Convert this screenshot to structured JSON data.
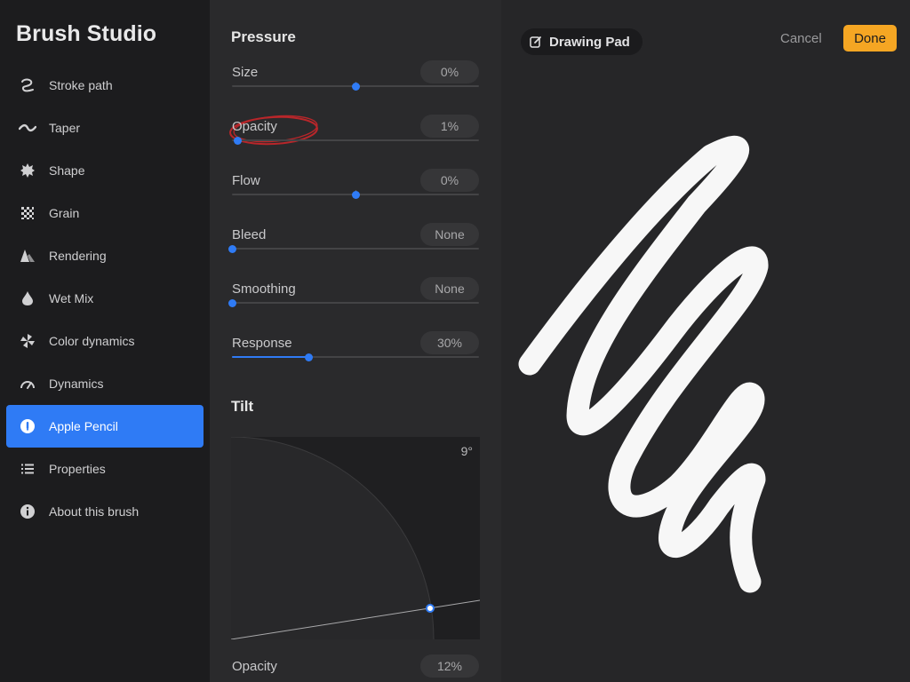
{
  "sidebar": {
    "title": "Brush Studio",
    "items": [
      {
        "label": "Stroke path",
        "icon": "stroke-path-icon"
      },
      {
        "label": "Taper",
        "icon": "taper-icon"
      },
      {
        "label": "Shape",
        "icon": "shape-icon"
      },
      {
        "label": "Grain",
        "icon": "grain-icon"
      },
      {
        "label": "Rendering",
        "icon": "rendering-icon"
      },
      {
        "label": "Wet Mix",
        "icon": "wet-mix-icon"
      },
      {
        "label": "Color dynamics",
        "icon": "color-dynamics-icon"
      },
      {
        "label": "Dynamics",
        "icon": "dynamics-icon"
      },
      {
        "label": "Apple Pencil",
        "icon": "apple-pencil-icon",
        "active": true
      },
      {
        "label": "Properties",
        "icon": "properties-icon"
      },
      {
        "label": "About this brush",
        "icon": "info-icon"
      }
    ]
  },
  "pressure": {
    "title": "Pressure",
    "settings": [
      {
        "label": "Size",
        "value": "0%",
        "level": 0.5,
        "centered": true
      },
      {
        "label": "Opacity",
        "value": "1%",
        "level": 0.02,
        "centered": false
      },
      {
        "label": "Flow",
        "value": "0%",
        "level": 0.5,
        "centered": true
      },
      {
        "label": "Bleed",
        "value": "None",
        "level": 0,
        "centered": false
      },
      {
        "label": "Smoothing",
        "value": "None",
        "level": 0,
        "centered": false
      },
      {
        "label": "Response",
        "value": "30%",
        "level": 0.31,
        "centered": false,
        "filled": true
      }
    ]
  },
  "tilt": {
    "title": "Tilt",
    "angle": "9°",
    "opacity_label": "Opacity",
    "opacity_value": "12%"
  },
  "canvas": {
    "pad_label": "Drawing Pad",
    "cancel_label": "Cancel",
    "done_label": "Done"
  },
  "colors": {
    "accent": "#2f7bf5",
    "done": "#f5a623",
    "annotation": "#b8262a"
  }
}
